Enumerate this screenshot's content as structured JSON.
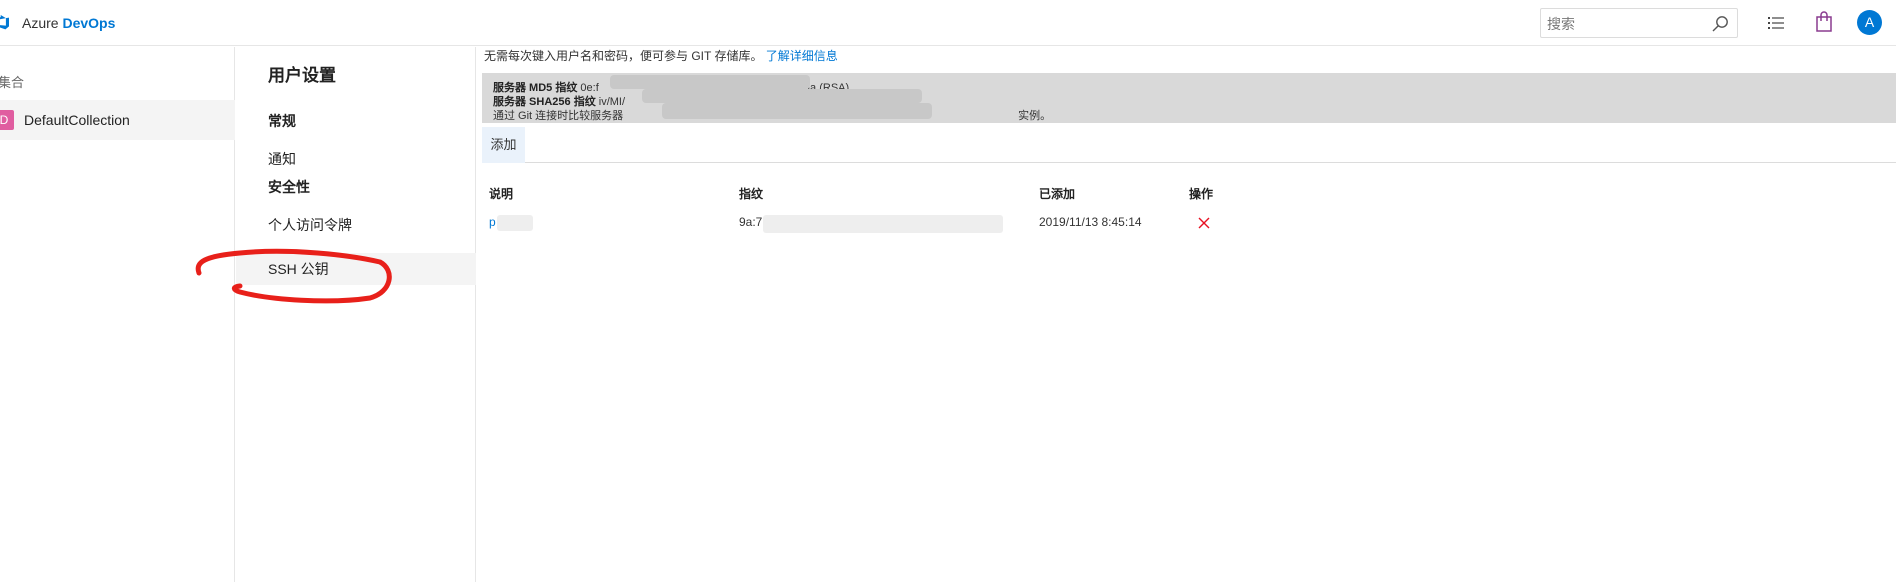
{
  "topbar": {
    "brand_azure": "Azure",
    "brand_devops": "DevOps",
    "search_placeholder": "搜索",
    "avatar_initial": "A",
    "icons": [
      "azure-devops-logo-icon",
      "search-icon",
      "list-icon",
      "shopping-bag-icon"
    ]
  },
  "left_pane": {
    "section_label": "集合",
    "collection": {
      "badge": "D",
      "name": "DefaultCollection",
      "badge_color": "#e05da0"
    }
  },
  "settings_nav": {
    "title": "用户设置",
    "group_general": "常规",
    "item_notifications": "通知",
    "group_security": "安全性",
    "item_pat": "个人访问令牌",
    "item_ssh": "SSH 公钥"
  },
  "main": {
    "description": "无需每次键入用户名和密码，便可参与 GIT 存储库。",
    "learn_more": "了解详细信息",
    "fingerprints": {
      "md5_label": "服务器 MD5 指纹",
      "md5_value_visible_start": "0e:f",
      "md5_value_visible_end": "9:aa (RSA)",
      "sha256_label": "服务器 SHA256 指纹",
      "sha256_value_visible_start": "iv/MI/",
      "compare_text_start": "通过 Git 连接时比较服务器",
      "compare_text_end": "实例。"
    },
    "add_button": "添加",
    "table": {
      "columns": [
        "说明",
        "指纹",
        "已添加",
        "操作"
      ],
      "rows": [
        {
          "description": "p",
          "fingerprint": "9a:7",
          "added": "2019/11/13 8:45:14"
        }
      ]
    }
  },
  "colors": {
    "accent": "#0078d4",
    "delete": "#e81123",
    "annotation": "#e8201a"
  }
}
